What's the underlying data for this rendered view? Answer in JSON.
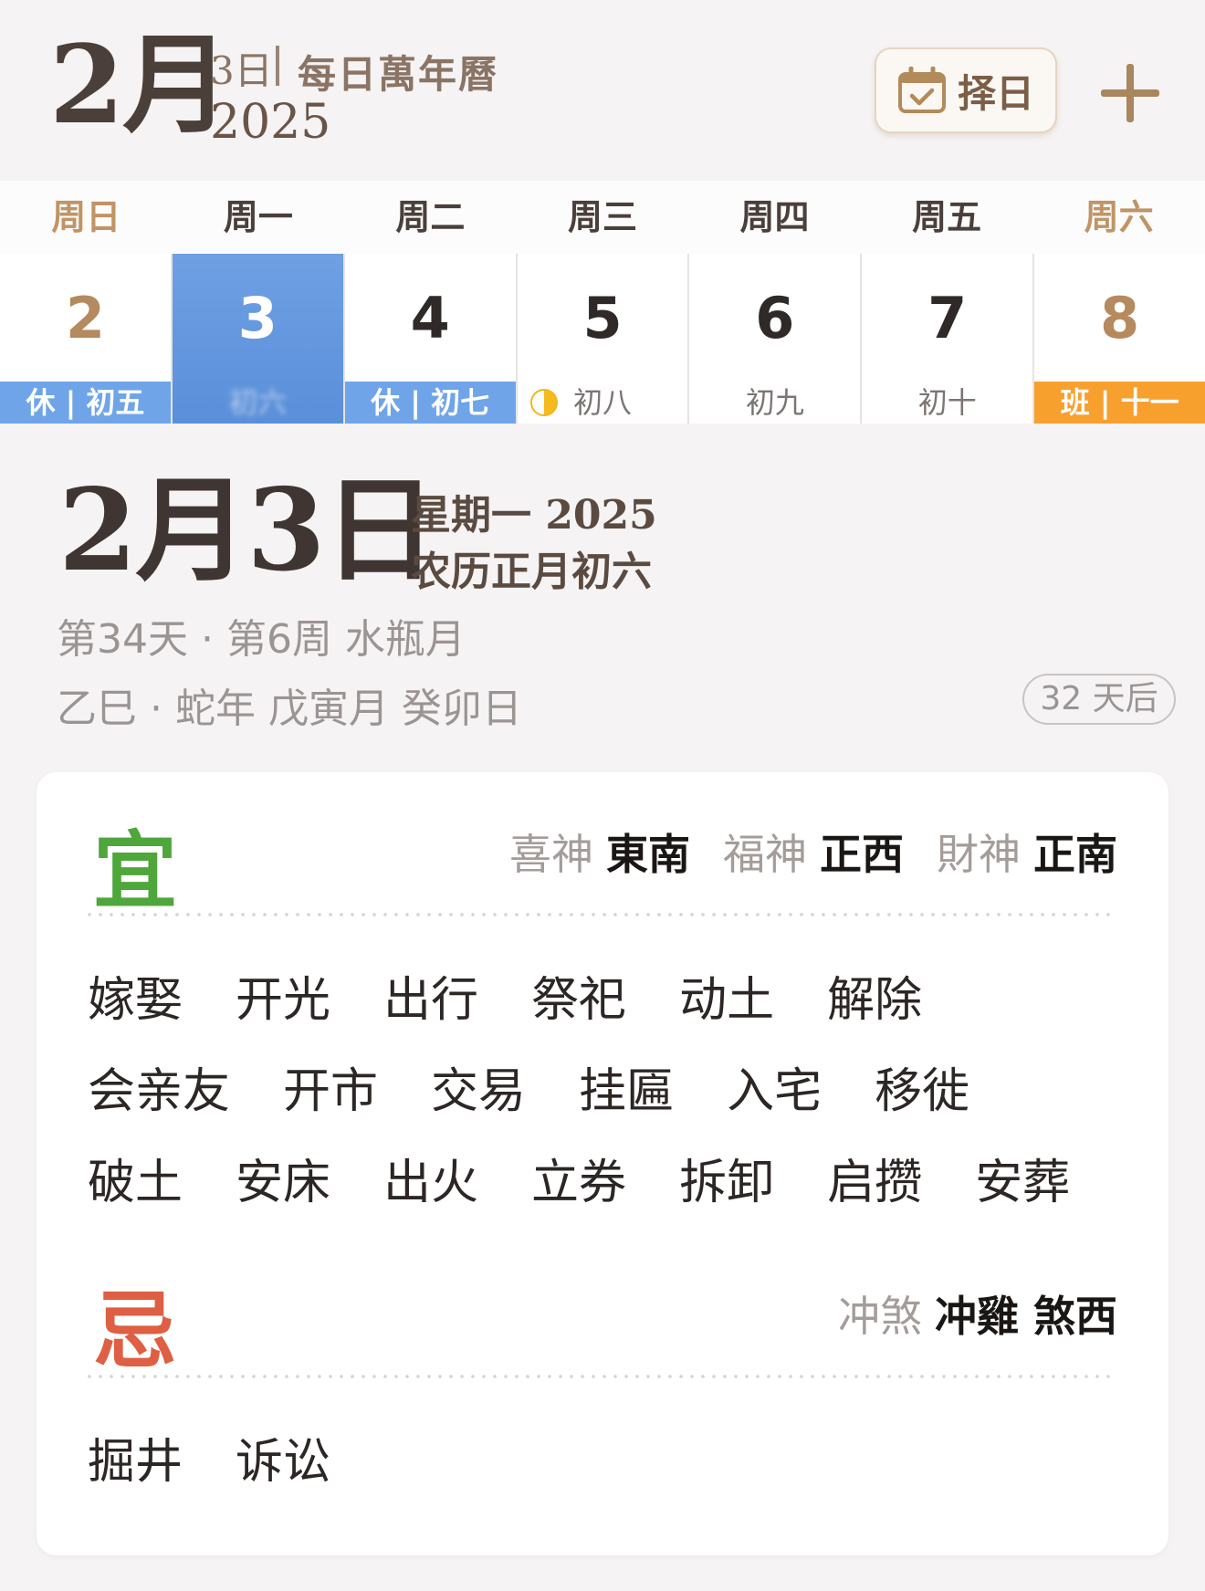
{
  "header": {
    "month": "2月",
    "day": "3日",
    "app_title": "每日萬年曆",
    "year": "2025",
    "pick_day_label": "择日"
  },
  "week": {
    "headers": [
      "周日",
      "周一",
      "周二",
      "周三",
      "周四",
      "周五",
      "周六"
    ],
    "days": [
      {
        "num": "2",
        "sub": "休 | 初五"
      },
      {
        "num": "3",
        "sub": "初六"
      },
      {
        "num": "4",
        "sub": "休 | 初七"
      },
      {
        "num": "5",
        "sub": "初八"
      },
      {
        "num": "6",
        "sub": "初九"
      },
      {
        "num": "7",
        "sub": "初十"
      },
      {
        "num": "8",
        "sub": "班 | 十一"
      }
    ]
  },
  "detail": {
    "big_date": "2月3日",
    "weekday_year": "星期一 2025",
    "lunar": "农历正月初六",
    "info1": "第34天 · 第6周 水瓶月",
    "info2": "乙巳 · 蛇年 戊寅月 癸卯日",
    "countdown": "32 天后"
  },
  "almanac": {
    "yi_label": "宜",
    "ji_label": "忌",
    "gods": {
      "xi_key": "喜神",
      "xi_val": "東南",
      "fu_key": "福神",
      "fu_val": "正西",
      "cai_key": "財神",
      "cai_val": "正南"
    },
    "chong": {
      "key": "冲煞",
      "val": "冲雞 煞西"
    },
    "yi_rows": [
      [
        "嫁娶",
        "开光",
        "出行",
        "祭祀",
        "动土",
        "解除"
      ],
      [
        "会亲友",
        "开市",
        "交易",
        "挂匾",
        "入宅",
        "移徙"
      ],
      [
        "破土",
        "安床",
        "出火",
        "立券",
        "拆卸",
        "启攒",
        "安葬"
      ]
    ],
    "ji_rows": [
      [
        "掘井",
        "诉讼"
      ]
    ]
  },
  "colors": {
    "selected_day": "#5a8fd9",
    "rest_badge": "#6fa5e8",
    "work_badge": "#f7a02e",
    "yi": "#4fa63a",
    "ji": "#de5f44",
    "accent_brown": "#a9865e"
  }
}
